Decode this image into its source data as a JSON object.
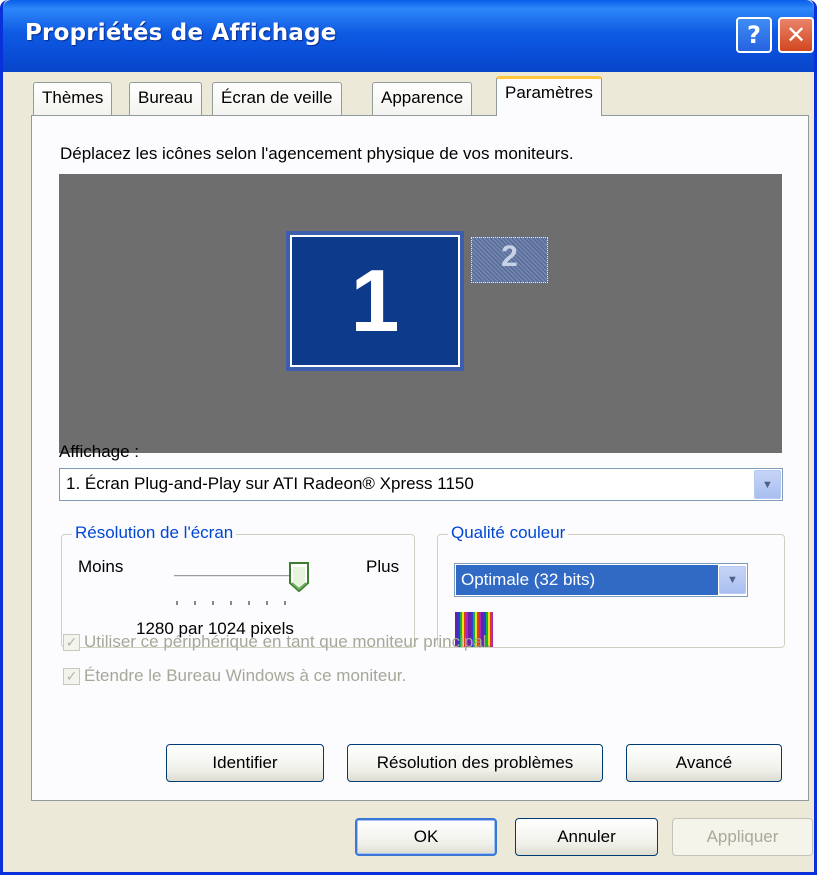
{
  "window": {
    "title": "Propriétés de Affichage",
    "help_label": "?",
    "close_label": "✕"
  },
  "tabs": [
    {
      "label": "Thèmes",
      "active": false
    },
    {
      "label": "Bureau",
      "active": false
    },
    {
      "label": "Écran de veille",
      "active": false
    },
    {
      "label": "Apparence",
      "active": false
    },
    {
      "label": "Paramètres",
      "active": true
    }
  ],
  "settings": {
    "instruction": "Déplacez les icônes selon l'agencement physique de vos moniteurs.",
    "monitors": [
      {
        "number": "1",
        "selected": true
      },
      {
        "number": "2",
        "selected": false
      }
    ],
    "display_label": "Affichage :",
    "display_value": "1. Écran Plug-and-Play sur ATI Radeon® Xpress 1150",
    "resolution": {
      "title": "Résolution de l'écran",
      "less_label": "Moins",
      "more_label": "Plus",
      "value_text": "1280 par 1024 pixels",
      "slider_level": 1.0
    },
    "color_quality": {
      "title": "Qualité couleur",
      "value": "Optimale (32 bits)"
    },
    "checkboxes": [
      {
        "label": "Utiliser ce périphérique en tant que moniteur principal.",
        "checked": true,
        "enabled": false
      },
      {
        "label": "Étendre le Bureau Windows à ce moniteur.",
        "checked": true,
        "enabled": false
      }
    ],
    "buttons": {
      "identify": "Identifier",
      "troubleshoot": "Résolution des problèmes",
      "advanced": "Avancé"
    }
  },
  "footer": {
    "ok": "OK",
    "cancel": "Annuler",
    "apply": "Appliquer"
  },
  "colors": {
    "title_blue": "#0A4ED8",
    "selection_blue": "#316AC5",
    "group_title": "#0046D5",
    "active_tab_accent": "#FFC83C"
  }
}
